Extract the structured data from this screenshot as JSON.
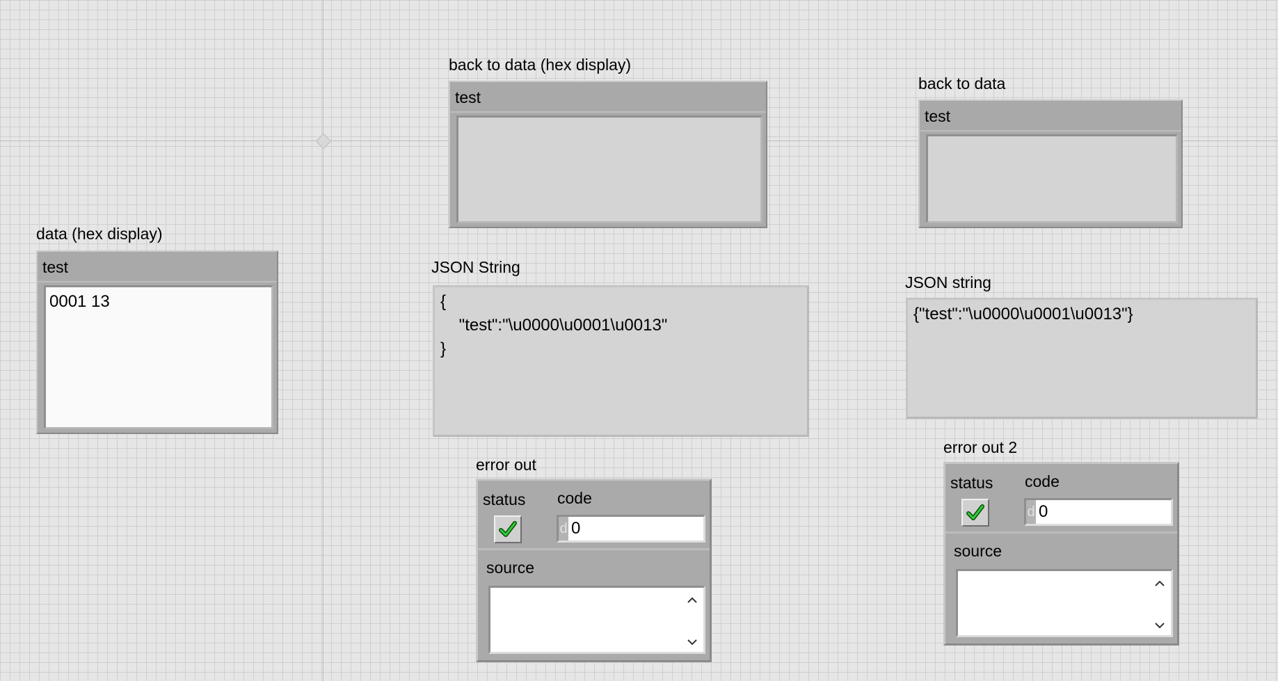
{
  "canvas": {
    "bg": "#e6e6e6",
    "grid": "#cfcfcf"
  },
  "data_hex": {
    "label": "data (hex display)",
    "field_label": "test",
    "value": "0001 13"
  },
  "back_to_data_hex": {
    "label": "back to data (hex display)",
    "field_label": "test",
    "value": ""
  },
  "back_to_data": {
    "label": "back to data",
    "field_label": "test",
    "value": ""
  },
  "json_string_pretty": {
    "label": "JSON String",
    "value": "{\n    \"test\":\"\\u0000\\u0001\\u0013\"\n}"
  },
  "json_string": {
    "label": "JSON string",
    "value": "{\"test\":\"\\u0000\\u0001\\u0013\"}"
  },
  "error_out": {
    "label": "error out",
    "status_label": "status",
    "code_label": "code",
    "code_prefix": "d",
    "code_value": "0",
    "source_label": "source",
    "source_value": "",
    "status_icon": "check-icon",
    "status_color": "#2ecc40"
  },
  "error_out_2": {
    "label": "error out 2",
    "status_label": "status",
    "code_label": "code",
    "code_prefix": "d",
    "code_value": "0",
    "source_label": "source",
    "source_value": "",
    "status_icon": "check-icon",
    "status_color": "#2ecc40"
  }
}
